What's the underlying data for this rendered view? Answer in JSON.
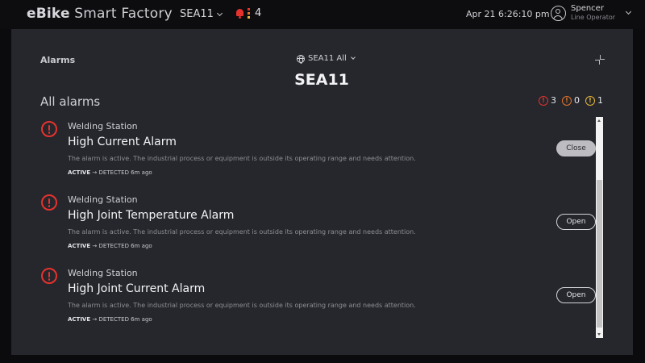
{
  "app": {
    "brand": "eBike Smart Factory"
  },
  "topbar": {
    "site": "SEA11",
    "notification_count": "4",
    "datetime": "Apr 21  6:26:10 pm",
    "user_name": "Spencer",
    "user_role": "Line Operator"
  },
  "panel": {
    "title": "Alarms",
    "scope": "SEA11 All",
    "site_heading": "SEA11",
    "list_title": "All alarms",
    "counts": {
      "critical": "3",
      "major": "0",
      "minor": "1"
    }
  },
  "alarms": [
    {
      "station": "Welding Station",
      "title": "High Current Alarm",
      "description": "The alarm is active. The industrial process or equipment is outside its operating range and needs attention.",
      "state": "ACTIVE",
      "detail": "→ DETECTED 6m ago",
      "action": "Close"
    },
    {
      "station": "Welding Station",
      "title": "High Joint Temperature Alarm",
      "description": "The alarm is active. The industrial process or equipment is outside its operating range and needs attention.",
      "state": "ACTIVE",
      "detail": "→ DETECTED 6m ago",
      "action": "Open"
    },
    {
      "station": "Welding Station",
      "title": "High Joint Current Alarm",
      "description": "The alarm is active. The industrial process or equipment is outside its operating range and needs attention.",
      "state": "ACTIVE",
      "detail": "→ DETECTED 6m ago",
      "action": "Open"
    }
  ],
  "colors": {
    "critical": "#e5322d",
    "major": "#e5752a",
    "minor": "#e8b93a",
    "panel_bg": "#25272d"
  }
}
